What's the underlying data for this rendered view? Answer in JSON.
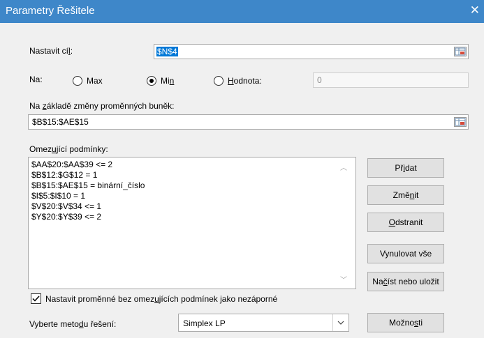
{
  "window": {
    "title": "Parametry Řešitele"
  },
  "objective": {
    "label_pre": "Nastavit cí",
    "label_key": "l",
    "label_post": ":",
    "value": "$N$4"
  },
  "to": {
    "label": "Na:",
    "max": "Max",
    "min_pre": "Mi",
    "min_key": "n",
    "value_key": "H",
    "value_post": "odnota:",
    "value_field": "0",
    "selected": "Min"
  },
  "variables": {
    "label_pre": "Na ",
    "label_key": "z",
    "label_post": "ákladě změny proměnných buněk:",
    "value": "$B$15:$AE$15"
  },
  "constraints": {
    "label_pre": "Omez",
    "label_key": "u",
    "label_post": "jící podmínky:",
    "items": [
      "$AA$20:$AA$39 <= 2",
      "$B$12:$G$12 = 1",
      "$B$15:$AE$15 = binární_číslo",
      "$I$5:$I$10 = 1",
      "$V$20:$V$34 <= 1",
      "$Y$20:$Y$39 <= 2"
    ]
  },
  "buttons": {
    "add_pre": "Př",
    "add_key": "i",
    "add_post": "dat",
    "change_pre": "Změ",
    "change_key": "n",
    "change_post": "it",
    "delete_key": "O",
    "delete_post": "dstranit",
    "reset": "Vynulovat vše",
    "load_pre": "Na",
    "load_key": "č",
    "load_post": "íst nebo uložit",
    "options_pre": "Možno",
    "options_key": "s",
    "options_post": "ti"
  },
  "nonneg": {
    "label_pre": "Nastavit proměnné bez omez",
    "label_key": "u",
    "label_post": "jících podmínek jako nezáporné",
    "checked": true
  },
  "method": {
    "label_pre": "Vyberte meto",
    "label_key": "d",
    "label_post": "u řešení:",
    "value": "Simplex LP"
  }
}
